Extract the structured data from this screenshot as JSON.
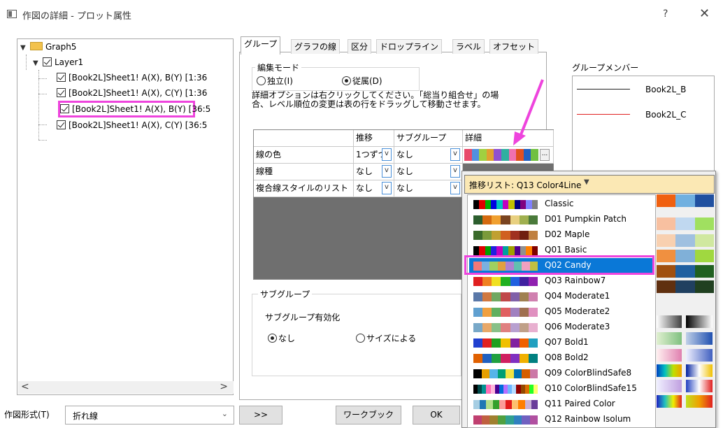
{
  "window": {
    "title": "作図の詳細 - プロット属性",
    "help": "?",
    "close": "✕"
  },
  "tree": {
    "root": "Graph5",
    "layer": "Layer1",
    "items": [
      "[Book2L]Sheet1! A(X), B(Y) [1:36",
      "[Book2L]Sheet1! A(X), C(Y) [1:36",
      "[Book2L]Sheet1! A(X), B(Y) [36:5",
      "[Book2L]Sheet1! A(X), C(Y) [36:5"
    ],
    "scroll_left": "<",
    "scroll_right": ">"
  },
  "bottom": {
    "plot_type_label": "作図形式(T)",
    "plot_type_value": "折れ線",
    "expand_button": ">>",
    "workbook_button": "ワークブック",
    "ok_button": "OK"
  },
  "tabs": [
    "グループ",
    "グラフの線",
    "区分",
    "ドロップライン",
    "ラベル",
    "オフセット"
  ],
  "edit_mode": {
    "title": "編集モード",
    "independent": "独立(I)",
    "dependent": "従属(D)"
  },
  "help_text": "詳細オプションは右クリックしてください。「総当り組合せ」の場合、レベル順位の変更は表の行をドラッグして移動させます。",
  "grid": {
    "headers": [
      "",
      "推移",
      "サブグループ",
      "詳細"
    ],
    "rows": [
      {
        "label": "線の色",
        "transition": "1つずつ",
        "subgroup": "なし"
      },
      {
        "label": "線種",
        "transition": "なし",
        "subgroup": "なし"
      },
      {
        "label": "複合線スタイルのリスト",
        "transition": "なし",
        "subgroup": "なし"
      }
    ],
    "more_button": "..."
  },
  "subgroup": {
    "title": "サブグループ",
    "enable_label": "サブグループ有効化",
    "none": "なし",
    "by_size": "サイズによる"
  },
  "members": {
    "title": "グループメンバー",
    "items": [
      {
        "name": "Book2L_B",
        "color": "#222222"
      },
      {
        "name": "Book2L_C",
        "color": "#e02020"
      }
    ]
  },
  "popup": {
    "header": "推移リスト: Q13 Color4Line",
    "palettes": [
      {
        "name": "Classic",
        "colors": [
          "#000000",
          "#e00000",
          "#00b000",
          "#0000e0",
          "#00c0c0",
          "#c000c0",
          "#c0c000",
          "#000080",
          "#800080",
          "#8080ff",
          "#808080"
        ]
      },
      {
        "name": "D01 Pumpkin Patch",
        "colors": [
          "#2c5e2e",
          "#d46a10",
          "#f0a030",
          "#7a4420",
          "#e8d080",
          "#a0b050",
          "#4a7a3a"
        ]
      },
      {
        "name": "D02 Maple",
        "colors": [
          "#3a6a2a",
          "#7a9a3a",
          "#c0a030",
          "#d06020",
          "#a03020",
          "#702010",
          "#c08040"
        ]
      },
      {
        "name": "Q01 Basic",
        "colors": [
          "#000000",
          "#e00000",
          "#00a000",
          "#2020e0",
          "#c000c0",
          "#00a0a0",
          "#a0a000",
          "#500090",
          "#909090",
          "#ff8000",
          "#800000"
        ]
      },
      {
        "name": "Q02 Candy",
        "colors": [
          "#f07878",
          "#7ab0e0",
          "#a0d060",
          "#e0a040",
          "#b080d0",
          "#60c0b0",
          "#f0a0c0",
          "#c0c040"
        ]
      },
      {
        "name": "Q03 Rainbow7",
        "colors": [
          "#e02020",
          "#f08020",
          "#f0e020",
          "#20b020",
          "#2060e0",
          "#4020a0",
          "#9020b0"
        ]
      },
      {
        "name": "Q04 Moderate1",
        "colors": [
          "#5a78a8",
          "#d07840",
          "#70a860",
          "#c04848",
          "#8060a8",
          "#a08050",
          "#d080b0"
        ]
      },
      {
        "name": "Q05 Moderate2",
        "colors": [
          "#60a0d0",
          "#f0a040",
          "#60b060",
          "#e06060",
          "#a080c0",
          "#a07050",
          "#e090c0"
        ]
      },
      {
        "name": "Q06 Moderate3",
        "colors": [
          "#78a8c8",
          "#e8a868",
          "#88c088",
          "#e08080",
          "#b8a0d0",
          "#c0a088",
          "#e8b0d0"
        ]
      },
      {
        "name": "Q07 Bold1",
        "colors": [
          "#2040d0",
          "#e02020",
          "#20a020",
          "#f0c000",
          "#8020a0",
          "#f06000",
          "#20a0c0"
        ]
      },
      {
        "name": "Q08 Bold2",
        "colors": [
          "#e06000",
          "#2060c0",
          "#20a040",
          "#d02060",
          "#8030c0",
          "#f0b000",
          "#008080"
        ]
      },
      {
        "name": "Q09 ColorBlindSafe8",
        "colors": [
          "#000000",
          "#e69f00",
          "#56b4e9",
          "#009e73",
          "#f0e442",
          "#0072b2",
          "#d55e00",
          "#cc79a7"
        ]
      },
      {
        "name": "Q10 ColorBlindSafe15",
        "colors": [
          "#000000",
          "#004949",
          "#009292",
          "#ff6db6",
          "#ffb6db",
          "#490092",
          "#006ddb",
          "#b66dff",
          "#6db6ff",
          "#b6dbff",
          "#920000",
          "#924900",
          "#db6d00",
          "#24ff24",
          "#ffff6d"
        ]
      },
      {
        "name": "Q11 Paired Color",
        "colors": [
          "#a6cee3",
          "#1f78b4",
          "#b2df8a",
          "#33a02c",
          "#fb9a99",
          "#e31a1c",
          "#fdbf6f",
          "#ff7f00",
          "#cab2d6",
          "#6a3d9a"
        ]
      },
      {
        "name": "Q12 Rainbow Isolum",
        "colors": [
          "#c04070",
          "#c06040",
          "#a08030",
          "#50a040",
          "#30a090",
          "#3080c0",
          "#7060c0",
          "#b050a0"
        ]
      }
    ],
    "selected": "Q02 Candy"
  },
  "accent_color": "#ee44dd",
  "selection_color": "#0a78d7"
}
